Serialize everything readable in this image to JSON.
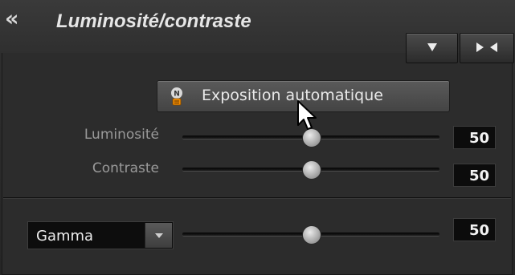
{
  "panel": {
    "title": "Luminosité/contraste",
    "collapse_icon": "double-chevron-left-icon",
    "header_buttons": [
      {
        "icon": "triangle-down-icon"
      },
      {
        "icon": "collapse-arrows-icon"
      }
    ]
  },
  "auto_exposure": {
    "label": "Exposition automatique",
    "icon": "auto-exposure-icon"
  },
  "controls": {
    "luminosite": {
      "label": "Luminosité",
      "value": "50",
      "level": 50
    },
    "contraste": {
      "label": "Contraste",
      "value": "50",
      "level": 50
    }
  },
  "gamma": {
    "selected": "Gamma",
    "value": "50",
    "level": 50
  },
  "colors": {
    "background": "#2e2e2e",
    "value_box": "#0c0c0c",
    "text": "#e6e6e6",
    "accent": "#f08a00"
  }
}
